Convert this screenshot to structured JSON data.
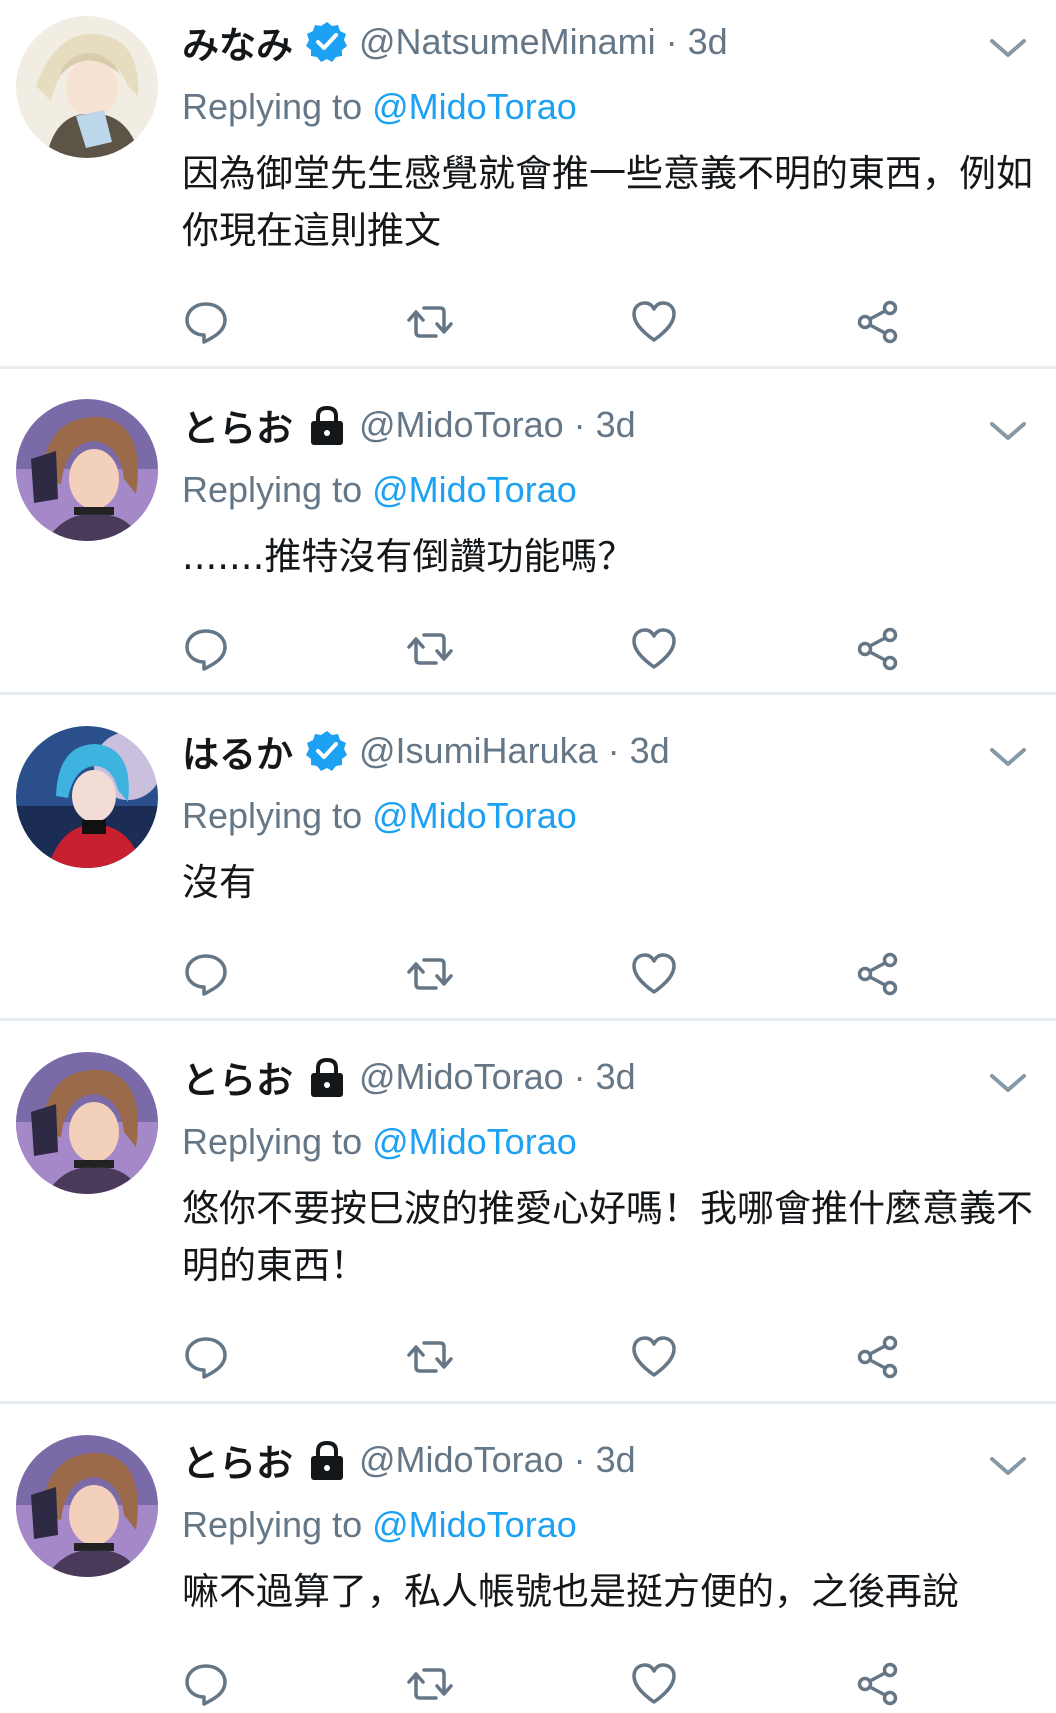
{
  "tweets": [
    {
      "name": "みなみ",
      "verified": true,
      "locked": false,
      "handle": "@NatsumeMinami · 3d",
      "replying_prefix": "Replying to ",
      "replying_to": "@MidoTorao",
      "text": "因為御堂先生感覺就會推一些意義不明的東西，例如你現在這則推文"
    },
    {
      "name": "とらお",
      "verified": false,
      "locked": true,
      "handle": "@MidoTorao · 3d",
      "replying_prefix": "Replying to ",
      "replying_to": "@MidoTorao",
      "text": ".......推特沒有倒讚功能嗎？"
    },
    {
      "name": "はるか",
      "verified": true,
      "locked": false,
      "handle": "@IsumiHaruka · 3d",
      "replying_prefix": "Replying to ",
      "replying_to": "@MidoTorao",
      "text": "沒有"
    },
    {
      "name": "とらお",
      "verified": false,
      "locked": true,
      "handle": "@MidoTorao · 3d",
      "replying_prefix": "Replying to ",
      "replying_to": "@MidoTorao",
      "text": "悠你不要按巳波的推愛心好嗎！我哪會推什麼意義不明的東西！"
    },
    {
      "name": "とらお",
      "verified": false,
      "locked": true,
      "handle": "@MidoTorao · 3d",
      "replying_prefix": "Replying to ",
      "replying_to": "@MidoTorao",
      "text": "嘛不過算了，私人帳號也是挺方便的，之後再說"
    }
  ],
  "icons": {
    "reply": "reply-icon",
    "retweet": "retweet-icon",
    "like": "heart-icon",
    "share": "share-icon",
    "more": "chevron-down-icon",
    "verified": "verified-badge-icon",
    "locked": "lock-icon"
  },
  "colors": {
    "accent": "#1da1f2",
    "secondary_text": "#657786",
    "divider": "#e6ecf0",
    "icon": "#657786"
  }
}
